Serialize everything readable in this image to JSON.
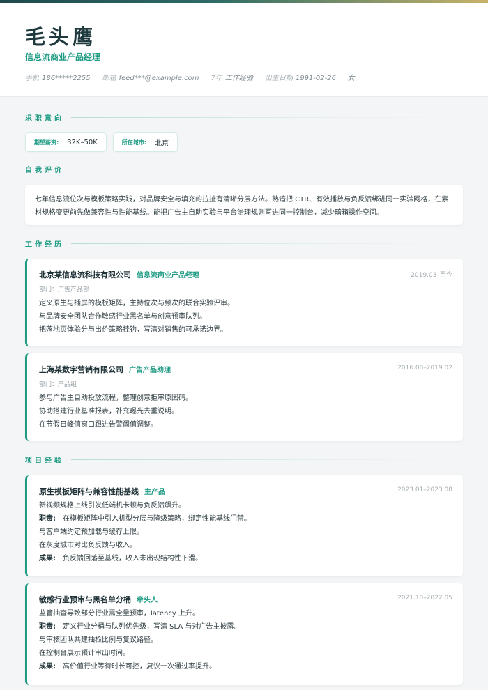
{
  "profile": {
    "name": "毛头鹰",
    "title": "信息流商业产品经理",
    "meta": [
      {
        "key": "手机",
        "value": "186*****2255"
      },
      {
        "key": "邮箱",
        "value": "feed***@example.com"
      },
      {
        "key": "7年",
        "value": "工作经验"
      },
      {
        "key": "出生日期",
        "value": "1991-02-26"
      },
      {
        "key": "",
        "value": "女"
      }
    ]
  },
  "intent": {
    "heading": "求职意向",
    "salary_label": "期望薪资:",
    "salary_value": "32K–50K",
    "city_label": "所在城市:",
    "city_value": "北京"
  },
  "summary": {
    "heading": "自我评价",
    "text": "七年信息流位次与模板策略实践，对品牌安全与填充的拉扯有清晰分层方法。熟谙把 CTR、有效播放与负反馈绑进同一实验网格，在素材规格变更前先做兼容性与性能基线。能把广告主自助实验与平台治理规则写进同一控制台，减少暗箱操作空间。"
  },
  "work": {
    "heading": "工作经历",
    "items": [
      {
        "company": "北京某信息流科技有限公司",
        "role": "信息流商业产品经理",
        "date": "2019.03–至今",
        "dept": "部门：广告产品部",
        "lines": [
          "定义原生与插屏的模板矩阵，主持位次与频次的联合实验评审。",
          "与品牌安全团队合作敏感行业黑名单与创意预审队列。",
          "把落地页体验分与出价策略挂钩，写清对销售的可承诺边界。"
        ]
      },
      {
        "company": "上海某数字营销有限公司",
        "role": "广告产品助理",
        "date": "2016.08–2019.02",
        "dept": "部门：产品组",
        "lines": [
          "参与广告主自助投放流程，整理创意拒审原因码。",
          "协助搭建行业基准报表，补充曝光去重说明。",
          "在节假日峰值窗口跟进告警阈值调整。"
        ]
      }
    ]
  },
  "projects": {
    "heading": "项目经验",
    "duty_label": "职责:",
    "result_label": "成果:",
    "items": [
      {
        "name": "原生模板矩阵与兼容性能基线",
        "role": "主产品",
        "date": "2023.01–2023.08",
        "intro": "新视频规格上线引发低端机卡顿与负反馈飙升。",
        "duty_first": "在模板矩阵中引入机型分层与降级策略，绑定性能基线门禁。",
        "duty_more": [
          "与客户端约定预加载与缓存上限。",
          "在灰度城市对比负反馈与收入。"
        ],
        "result": "负反馈回落至基线，收入未出现结构性下滑。"
      },
      {
        "name": "敏感行业预审与黑名单分桶",
        "role": "牵头人",
        "date": "2021.10–2022.05",
        "intro": "监管抽查导致部分行业需全量预审，latency 上升。",
        "duty_first": "定义行业分桶与队列优先级，写清 SLA 与对广告主披露。",
        "duty_more": [
          "与审核团队共建抽检比例与复议路径。",
          "在控制台展示预计审出时间。"
        ],
        "result": "高价值行业等待时长可控，复议一次通过率提升。"
      }
    ]
  }
}
